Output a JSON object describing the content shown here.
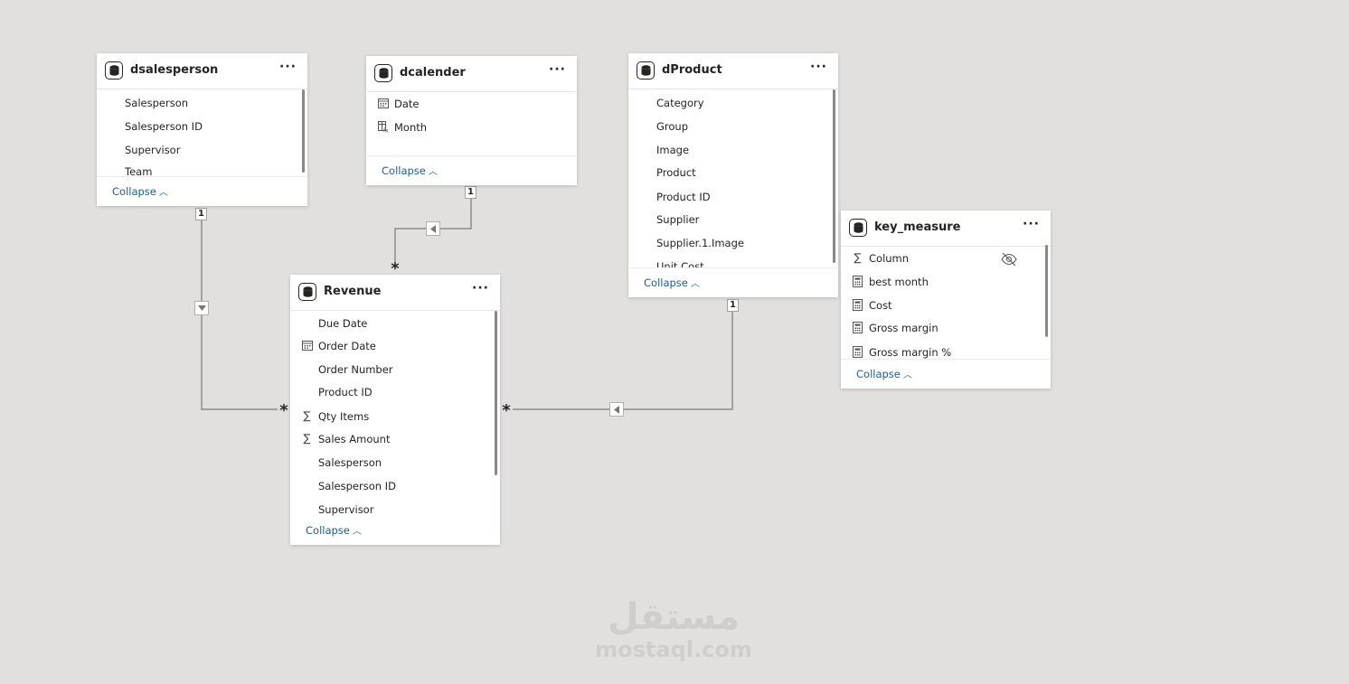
{
  "tables": {
    "dsalesperson": {
      "name": "dsalesperson",
      "more": "···",
      "fields": [
        {
          "icon": "",
          "label": "Salesperson"
        },
        {
          "icon": "",
          "label": "Salesperson ID"
        },
        {
          "icon": "",
          "label": "Supervisor"
        },
        {
          "icon": "",
          "label": "Team"
        }
      ],
      "collapse_label": "Collapse"
    },
    "dcalender": {
      "name": "dcalender",
      "more": "···",
      "fields": [
        {
          "icon": "calendar-icon",
          "label": "Date"
        },
        {
          "icon": "calculated-column-icon",
          "label": "Month"
        }
      ],
      "collapse_label": "Collapse"
    },
    "dProduct": {
      "name": "dProduct",
      "more": "···",
      "fields": [
        {
          "icon": "",
          "label": "Category"
        },
        {
          "icon": "",
          "label": "Group"
        },
        {
          "icon": "",
          "label": "Image"
        },
        {
          "icon": "",
          "label": "Product"
        },
        {
          "icon": "",
          "label": "Product ID"
        },
        {
          "icon": "",
          "label": "Supplier"
        },
        {
          "icon": "",
          "label": "Supplier.1.Image"
        },
        {
          "icon": "",
          "label": "Unit Cost"
        }
      ],
      "collapse_label": "Collapse"
    },
    "key_measure": {
      "name": "key_measure",
      "more": "···",
      "fields": [
        {
          "icon": "sigma-icon",
          "label": "Column"
        },
        {
          "icon": "measure-icon",
          "label": "best month"
        },
        {
          "icon": "measure-icon",
          "label": "Cost"
        },
        {
          "icon": "measure-icon",
          "label": "Gross margin"
        },
        {
          "icon": "measure-icon",
          "label": "Gross margin %"
        }
      ],
      "collapse_label": "Collapse"
    },
    "Revenue": {
      "name": "Revenue",
      "more": "···",
      "fields": [
        {
          "icon": "",
          "label": "Due Date"
        },
        {
          "icon": "calendar-icon",
          "label": "Order Date"
        },
        {
          "icon": "",
          "label": "Order Number"
        },
        {
          "icon": "",
          "label": "Product ID"
        },
        {
          "icon": "sigma-icon",
          "label": "Qty Items"
        },
        {
          "icon": "sigma-icon",
          "label": "Sales Amount"
        },
        {
          "icon": "",
          "label": "Salesperson"
        },
        {
          "icon": "",
          "label": "Salesperson ID"
        },
        {
          "icon": "",
          "label": "Supervisor"
        }
      ],
      "collapse_label": "Collapse"
    }
  },
  "relationships": {
    "one": "1",
    "many": "*"
  },
  "watermark": {
    "arabic": "مستقل",
    "latin": "mostaql.com"
  },
  "colors": {
    "canvas": "#e1e0df",
    "card": "#ffffff",
    "link": "#1b5f8a",
    "line": "#7a7a7a"
  }
}
